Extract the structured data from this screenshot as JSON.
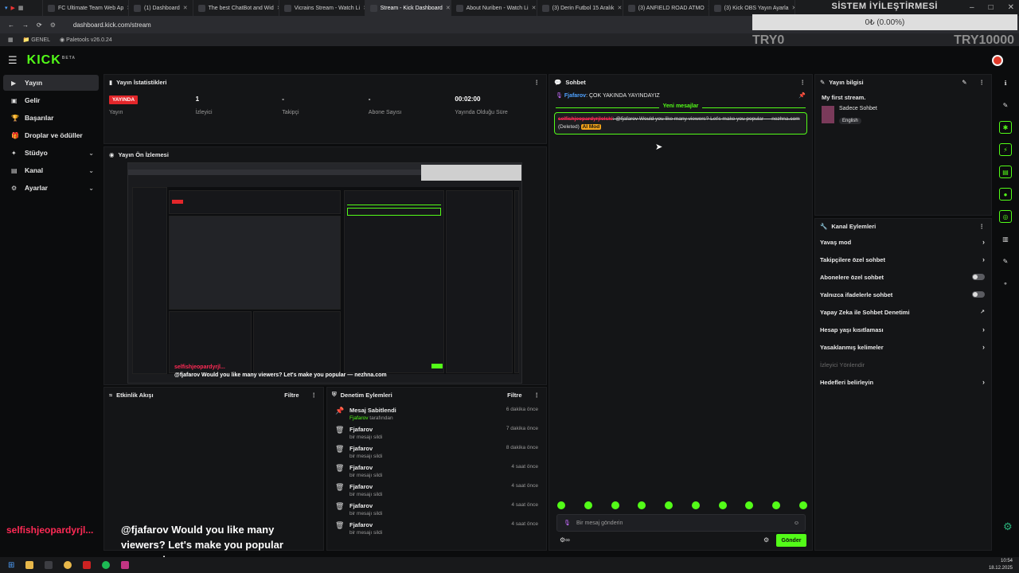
{
  "browser": {
    "tabs": [
      {
        "label": "FC Ultimate Team Web Ap",
        "active": false
      },
      {
        "label": "(1) Dashboard",
        "active": false
      },
      {
        "label": "The best ChatBot and Wid",
        "active": false
      },
      {
        "label": "Vicrains Stream - Watch Li",
        "active": false
      },
      {
        "label": "Stream - Kick Dashboard",
        "active": true
      },
      {
        "label": "About Nuriben - Watch Li",
        "active": false
      },
      {
        "label": "(3) Derin Futbol 15 Aralık",
        "active": false
      },
      {
        "label": "(3) ANFIELD ROAD ATMO",
        "active": false
      },
      {
        "label": "(3) Kick OBS Yayın Ayarla",
        "active": false
      }
    ],
    "url": "dashboard.kick.com/stream",
    "bookmarks": [
      "GENEL",
      "Paletools v26.0.24"
    ]
  },
  "overlay": {
    "title": "SİSTEM İYİLEŞTİRMESİ",
    "progress": "0₺ (0.00%)",
    "left_label": "TRY0",
    "right_label": "TRY10000"
  },
  "header": {
    "logo": "KICK",
    "logo_badge": "BETA"
  },
  "nav": {
    "items": [
      {
        "label": "Yayın",
        "selected": true,
        "expandable": false
      },
      {
        "label": "Gelir",
        "selected": false,
        "expandable": false
      },
      {
        "label": "Başarılar",
        "selected": false,
        "expandable": false
      },
      {
        "label": "Droplar ve ödüller",
        "selected": false,
        "expandable": false
      },
      {
        "label": "Stüdyo",
        "selected": false,
        "expandable": true
      },
      {
        "label": "Kanal",
        "selected": false,
        "expandable": true
      },
      {
        "label": "Ayarlar",
        "selected": false,
        "expandable": true
      }
    ]
  },
  "stats": {
    "title": "Yayın İstatistikleri",
    "items": [
      {
        "value": "YAYINDA",
        "label": "Yayın"
      },
      {
        "value": "1",
        "label": "İzleyici"
      },
      {
        "value": "-",
        "label": "Takipçi"
      },
      {
        "value": "-",
        "label": "Abone Sayısı"
      },
      {
        "value": "00:02:00",
        "label": "Yayında Olduğu Süre"
      }
    ]
  },
  "preview": {
    "title": "Yayın Ön İzlemesi",
    "caption_name": "selfishjeopardyrjl...",
    "caption_text": "@fjafarov Would you like many viewers? Let's make you popular — nezhna.com"
  },
  "activity": {
    "title": "Etkinlik Akışı",
    "filter": "Filtre"
  },
  "moderation": {
    "title": "Denetim Eylemleri",
    "filter": "Filtre",
    "items": [
      {
        "name": "Mesaj Sabitlendi",
        "sub_user": "Fjafarov",
        "sub": "tarafından",
        "time": "6 dakika önce",
        "icon": "pin"
      },
      {
        "name": "Fjafarov",
        "sub_user": "",
        "sub": "bir mesajı sildi",
        "time": "7 dakika önce",
        "icon": "trash"
      },
      {
        "name": "Fjafarov",
        "sub_user": "",
        "sub": "bir mesajı sildi",
        "time": "8 dakika önce",
        "icon": "trash"
      },
      {
        "name": "Fjafarov",
        "sub_user": "",
        "sub": "bir mesajı sildi",
        "time": "4 saat önce",
        "icon": "trash"
      },
      {
        "name": "Fjafarov",
        "sub_user": "",
        "sub": "bir mesajı sildi",
        "time": "4 saat önce",
        "icon": "trash"
      },
      {
        "name": "Fjafarov",
        "sub_user": "",
        "sub": "bir mesajı sildi",
        "time": "4 saat önce",
        "icon": "trash"
      },
      {
        "name": "Fjafarov",
        "sub_user": "",
        "sub": "bir mesajı sildi",
        "time": "4 saat önce",
        "icon": "trash"
      }
    ]
  },
  "chat": {
    "title": "Sohbet",
    "pinned_user": "Fjafarov",
    "pinned_text": ": ÇOK YAKINDA YAYINDAYIZ",
    "new_messages": "Yeni mesajlar",
    "deleted_user": "selfishjeopardyrjlolski",
    "deleted_text": ": @fjafarov Would you like many viewers? Let's make you popular — nezhna.com",
    "deleted_tag": "(Deleted)",
    "ai_tag": "AI Mod",
    "input_placeholder": "Bir mesaj gönderin",
    "send": "Gönder"
  },
  "stream_info": {
    "title": "Yayın bilgisi",
    "stream_title": "My first stream.",
    "category": "Sadece Sohbet",
    "language": "English"
  },
  "channel_actions": {
    "title": "Kanal Eylemleri",
    "items": [
      {
        "label": "Yavaş mod",
        "control": "chevron"
      },
      {
        "label": "Takipçilere özel sohbet",
        "control": "chevron"
      },
      {
        "label": "Abonelere özel sohbet",
        "control": "toggle"
      },
      {
        "label": "Yalnızca ifadelerle sohbet",
        "control": "toggle"
      },
      {
        "label": "Yapay Zeka ile Sohbet Denetimi",
        "control": "external"
      },
      {
        "label": "Hesap yaşı kısıtlaması",
        "control": "chevron"
      },
      {
        "label": "Yasaklanmış kelimeler",
        "control": "chevron"
      },
      {
        "label": "İzleyici Yönlendir",
        "control": "disabled"
      },
      {
        "label": "Hedefleri belirleyin",
        "control": "chevron"
      }
    ]
  },
  "captions": {
    "name": "selfishjeopardyrjl...",
    "text_line1": "@fjafarov Would you like many",
    "text_line2": "viewers? Let's make you popular",
    "text_line3": "— nezhna.com"
  },
  "taskbar": {
    "time": "10:54",
    "date": "18.12.2025"
  },
  "colors": {
    "accent": "#53fc18",
    "live": "#e3262a",
    "ai_mod": "#f0a21a",
    "name_red": "#ff2a55"
  }
}
